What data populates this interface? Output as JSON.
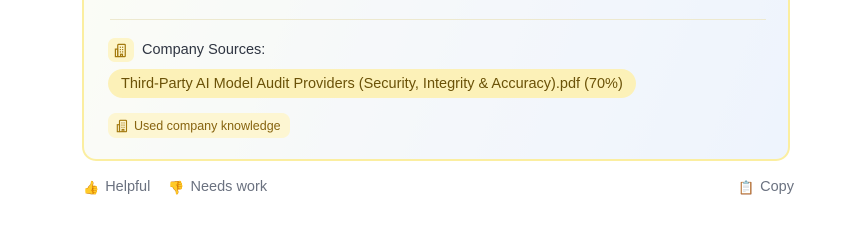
{
  "card": {
    "sources_title": "Company Sources:",
    "source_document": "Third-Party AI Model Audit Providers (Security, Integrity & Accuracy).pdf (70%)",
    "knowledge_badge": "Used company knowledge",
    "top_clipped_text": "(                                  )"
  },
  "feedback": {
    "helpful_label": "Helpful",
    "helpful_icon": "👍",
    "needs_work_label": "Needs work",
    "needs_work_icon": "👎",
    "copy_label": "Copy",
    "copy_icon": "📋"
  },
  "colors": {
    "card_border": "#fbeea0",
    "pill_bg": "#fcf1b8",
    "pill_text": "#6b5208",
    "badge_text": "#876410"
  }
}
